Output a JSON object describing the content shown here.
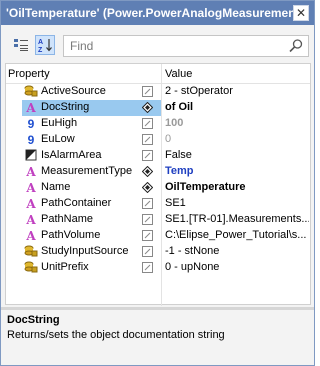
{
  "window": {
    "title": "'OilTemperature' (Power.PowerAnalogMeasurement)",
    "close_symbol": "✕"
  },
  "toolbar": {
    "categorized_icon": "categorized-view-icon",
    "alphabetical_icon": "alphabetical-sort-icon",
    "search_placeholder": "Find",
    "search_value": ""
  },
  "grid": {
    "header_property": "Property",
    "header_value": "Value",
    "selected_row": "DocString",
    "rows": [
      {
        "icon": "database-icon",
        "name": "ActiveSource",
        "marker": "pencil-icon",
        "value": "2 - stOperator",
        "style": "normal"
      },
      {
        "icon": "string-icon",
        "name": "DocString",
        "marker": "diamond-icon",
        "value": "of Oil",
        "style": "bold"
      },
      {
        "icon": "number-icon",
        "name": "EuHigh",
        "marker": "pencil-icon",
        "value": "100",
        "style": "grey-bold"
      },
      {
        "icon": "number-icon",
        "name": "EuLow",
        "marker": "pencil-icon",
        "value": "0",
        "style": "grey"
      },
      {
        "icon": "boolean-icon",
        "name": "IsAlarmArea",
        "marker": "pencil-icon",
        "value": "False",
        "style": "normal"
      },
      {
        "icon": "string-icon",
        "name": "MeasurementType",
        "marker": "diamond-icon",
        "value": "Temp",
        "style": "blue"
      },
      {
        "icon": "string-icon",
        "name": "Name",
        "marker": "diamond-icon",
        "value": "OilTemperature",
        "style": "bold"
      },
      {
        "icon": "string-icon",
        "name": "PathContainer",
        "marker": "pencil-icon",
        "value": "SE1",
        "style": "normal"
      },
      {
        "icon": "string-icon",
        "name": "PathName",
        "marker": "pencil-icon",
        "value": "SE1.[TR-01].Measurements...",
        "style": "normal"
      },
      {
        "icon": "string-icon",
        "name": "PathVolume",
        "marker": "pencil-icon",
        "value": "C:\\Elipse_Power_Tutorial\\s...",
        "style": "normal"
      },
      {
        "icon": "database-icon",
        "name": "StudyInputSource",
        "marker": "pencil-icon",
        "value": "-1 - stNone",
        "style": "normal"
      },
      {
        "icon": "database-icon",
        "name": "UnitPrefix",
        "marker": "pencil-icon",
        "value": "0 - upNone",
        "style": "normal"
      }
    ]
  },
  "help": {
    "title": "DocString",
    "description": "Returns/sets the object documentation string"
  },
  "colors": {
    "titlebar": "#5f7fb4",
    "selection": "#99c9ef",
    "string_icon": "#c040c0",
    "number_icon": "#2050d0",
    "database_icon": "#c8a020",
    "value_blue": "#1f3fc0",
    "value_grey": "#9a9a9a"
  }
}
